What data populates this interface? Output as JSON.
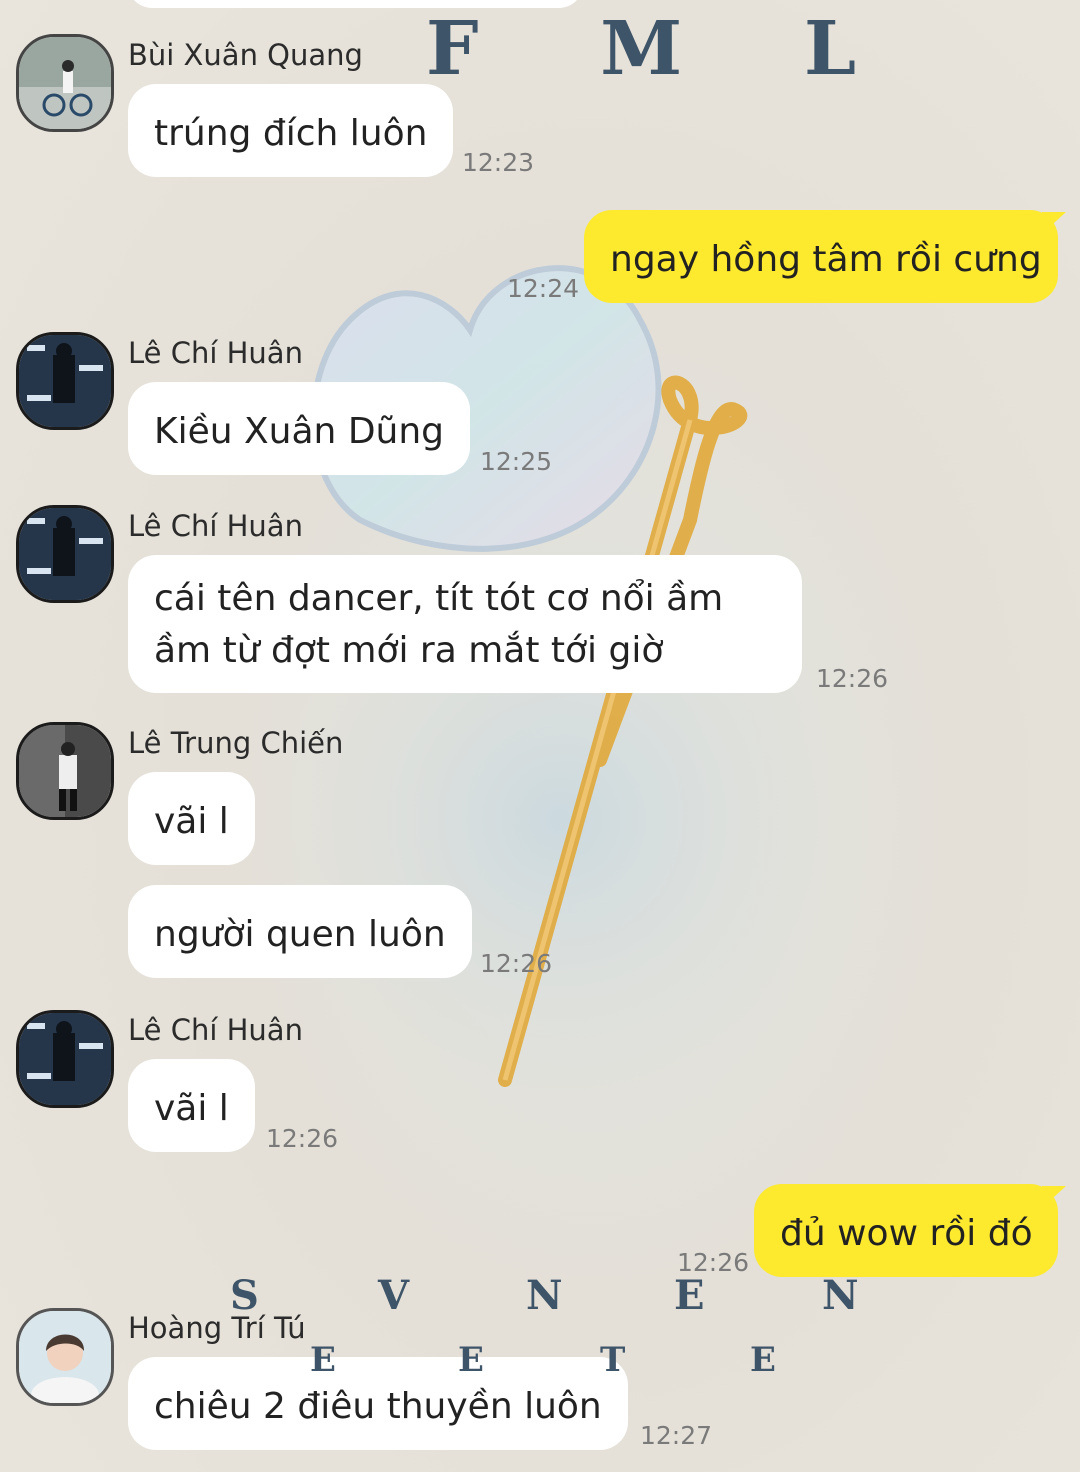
{
  "wallpaper": {
    "top_text": "F M L",
    "bottom_letters": [
      "S",
      "V",
      "N",
      "E",
      "N",
      "E",
      "E",
      "T",
      "E"
    ]
  },
  "messages": [
    {
      "sender": "Bùi Xuân Quang",
      "text": "trúng đích luôn",
      "time": "12:23"
    },
    {
      "sender": "",
      "text": "ngay hồng tâm rồi cưng",
      "time": "12:24",
      "outgoing": true
    },
    {
      "sender": "Lê Chí Huân",
      "text": "Kiều Xuân Dũng",
      "time": "12:25"
    },
    {
      "sender": "Lê Chí Huân",
      "text": "cái tên dancer,  tít tót cơ nổi ầm ầm từ đợt mới ra mắt tới giờ",
      "time": "12:26"
    },
    {
      "sender": "Lê Trung Chiến",
      "text": "vãi l",
      "time": ""
    },
    {
      "sender": "",
      "text": "người quen luôn",
      "time": "12:26"
    },
    {
      "sender": "Lê Chí Huân",
      "text": "vãi l",
      "time": "12:26"
    },
    {
      "sender": "",
      "text": "đủ wow rồi đó",
      "time": "12:26",
      "outgoing": true
    },
    {
      "sender": "Hoàng Trí Tú",
      "text": "chiêu 2 điêu thuyền luôn",
      "time": "12:27"
    }
  ],
  "colors": {
    "outgoing_bubble": "#fde92e",
    "incoming_bubble": "#ffffff",
    "heart_wire": "#e0a93a"
  }
}
